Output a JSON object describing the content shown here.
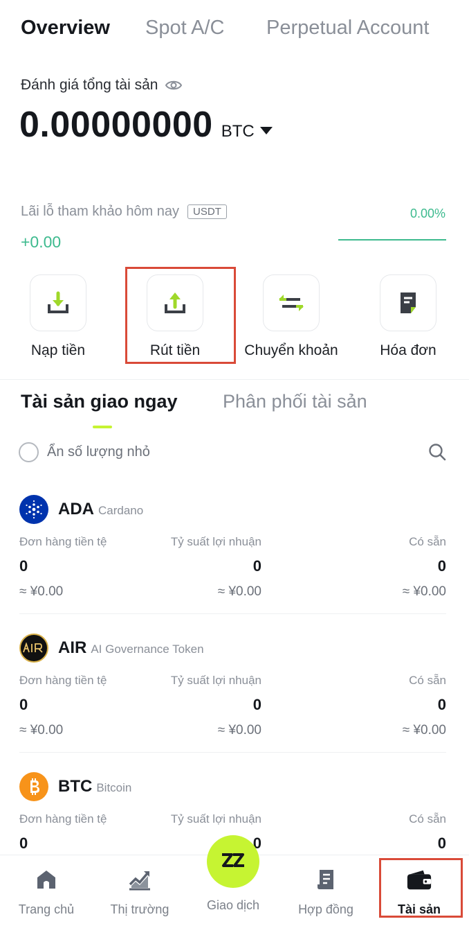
{
  "top_tabs": [
    {
      "label": "Overview"
    },
    {
      "label": "Spot A/C"
    },
    {
      "label": "Perpetual Account"
    }
  ],
  "valuation": {
    "label": "Đánh giá tổng tài sản",
    "value": "0.00000000",
    "unit": "BTC"
  },
  "pnl": {
    "label": "Lãi lỗ tham khảo hôm nay",
    "badge": "USDT",
    "value": "+0.00",
    "percent": "0.00%"
  },
  "actions": [
    {
      "label": "Nạp tiền",
      "icon": "deposit-icon"
    },
    {
      "label": "Rút tiền",
      "icon": "withdraw-icon"
    },
    {
      "label": "Chuyển khoản",
      "icon": "transfer-icon"
    },
    {
      "label": "Hóa đơn",
      "icon": "bill-icon"
    }
  ],
  "asset_tabs": [
    {
      "label": "Tài sản giao ngay"
    },
    {
      "label": "Phân phối tài sản"
    }
  ],
  "filter": {
    "hide_small_label": "Ẩn số lượng nhỏ"
  },
  "columns": {
    "order": "Đơn hàng tiền tệ",
    "yield": "Tỷ suất lợi nhuận",
    "available": "Có sẵn"
  },
  "assets": [
    {
      "symbol": "ADA",
      "name": "Cardano",
      "order": "0",
      "order_fiat": "≈ ¥0.00",
      "yield": "0",
      "yield_fiat": "≈ ¥0.00",
      "available": "0",
      "available_fiat": "≈ ¥0.00",
      "logo_color": "#0033ad"
    },
    {
      "symbol": "AIR",
      "name": "AI Governance Token",
      "order": "0",
      "order_fiat": "≈ ¥0.00",
      "yield": "0",
      "yield_fiat": "≈ ¥0.00",
      "available": "0",
      "available_fiat": "≈ ¥0.00",
      "logo_color": "#111111"
    },
    {
      "symbol": "BTC",
      "name": "Bitcoin",
      "order": "0",
      "yield": "0",
      "available": "0",
      "logo_color": "#f7931a"
    }
  ],
  "bottom_nav": [
    {
      "label": "Trang chủ",
      "icon": "home-icon"
    },
    {
      "label": "Thị trường",
      "icon": "market-chart-icon"
    },
    {
      "label": "Giao dịch",
      "icon": "trade-icon"
    },
    {
      "label": "Hợp đồng",
      "icon": "contract-icon"
    },
    {
      "label": "Tài sản",
      "icon": "wallet-icon"
    }
  ],
  "colors": {
    "accent": "#c6f432",
    "positive": "#3dba8e",
    "highlight": "#d94a38"
  }
}
